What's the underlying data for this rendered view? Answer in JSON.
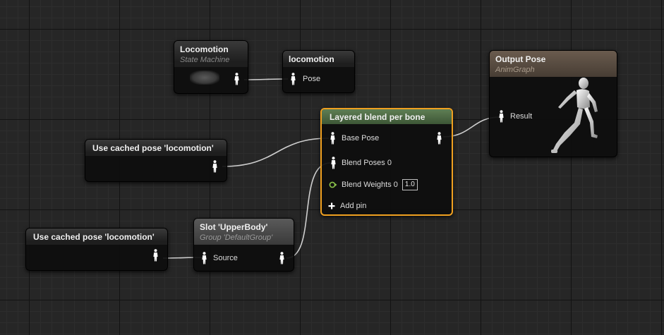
{
  "nodes": {
    "locomotion_sm": {
      "title": "Locomotion",
      "subtitle": "State Machine"
    },
    "locomotion_cache": {
      "title": "locomotion",
      "pin_pose": "Pose"
    },
    "layered_blend": {
      "title": "Layered blend per bone",
      "pin_base_pose": "Base Pose",
      "pin_blend_poses": "Blend Poses 0",
      "pin_blend_weights": "Blend Weights 0",
      "blend_weight_value": "1.0",
      "add_pin": "Add pin"
    },
    "output_pose": {
      "title": "Output Pose",
      "subtitle": "AnimGraph",
      "pin_result": "Result"
    },
    "cached_pose_1": {
      "title": "Use cached pose 'locomotion'"
    },
    "cached_pose_2": {
      "title": "Use cached pose 'locomotion'"
    },
    "slot": {
      "title": "Slot 'UpperBody'",
      "subtitle": "Group 'DefaultGroup'",
      "pin_source": "Source"
    }
  },
  "colors": {
    "blend_header": "#4e6b45",
    "output_header": "#5c5045",
    "selection": "#f0a020",
    "pose_pin": "#ffffff",
    "float_pin": "#8bc34a",
    "wire": "#cfcfcf"
  },
  "icons": [
    "pose-pin-icon",
    "float-pin-icon",
    "plus-icon",
    "mannequin-icon"
  ]
}
